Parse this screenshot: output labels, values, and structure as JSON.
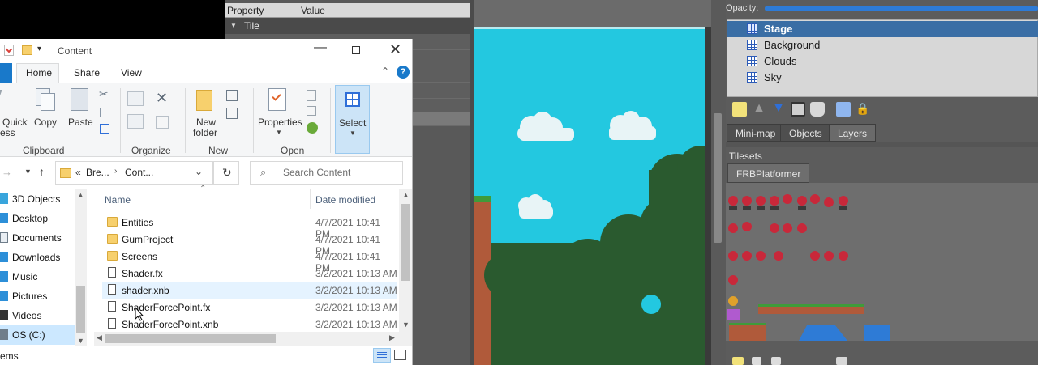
{
  "tiled": {
    "properties": {
      "col_property": "Property",
      "col_value": "Value",
      "group": "Tile"
    },
    "opacity_label": "Opacity:",
    "layers": [
      {
        "name": "Stage",
        "selected": true
      },
      {
        "name": "Background",
        "selected": false
      },
      {
        "name": "Clouds",
        "selected": false
      },
      {
        "name": "Sky",
        "selected": false
      }
    ],
    "panel_tabs": [
      "Mini-map",
      "Objects",
      "Layers"
    ],
    "active_panel_tab": "Layers",
    "tilesets_label": "Tilesets",
    "tileset_tab": "FRBPlatformer",
    "colors": {
      "sky": "#23c8e0",
      "foliage": "#2a5a2f",
      "layer_selected": "#3a6ea5",
      "enemy": "#c8283a"
    }
  },
  "explorer": {
    "window_title": "Content",
    "ribbon_tabs": [
      "Home",
      "Share",
      "View"
    ],
    "active_tab": "Home",
    "groups": {
      "clipboard": {
        "label": "Clipboard",
        "quick_access_1": "Quick",
        "quick_access_2": "ess",
        "copy": "Copy",
        "paste": "Paste"
      },
      "organize": {
        "label": "Organize"
      },
      "new": {
        "label": "New",
        "new_folder_1": "New",
        "new_folder_2": "folder"
      },
      "open": {
        "label": "Open",
        "properties": "Properties"
      },
      "select": {
        "label": "Select"
      }
    },
    "address": {
      "seg1": "Bre...",
      "seg2": "Cont...",
      "prefix": "«"
    },
    "search_placeholder": "Search Content",
    "nav_items": [
      {
        "label": "3D Objects",
        "icon": "3d-objects-icon"
      },
      {
        "label": "Desktop",
        "icon": "desktop-icon"
      },
      {
        "label": "Documents",
        "icon": "documents-icon"
      },
      {
        "label": "Downloads",
        "icon": "downloads-icon"
      },
      {
        "label": "Music",
        "icon": "music-icon"
      },
      {
        "label": "Pictures",
        "icon": "pictures-icon"
      },
      {
        "label": "Videos",
        "icon": "videos-icon"
      },
      {
        "label": "OS (C:)",
        "icon": "drive-icon"
      }
    ],
    "columns": {
      "name": "Name",
      "date": "Date modified"
    },
    "files": [
      {
        "name": "Entities",
        "date": "4/7/2021 10:41 PM",
        "type": "folder"
      },
      {
        "name": "GumProject",
        "date": "4/7/2021 10:41 PM",
        "type": "folder"
      },
      {
        "name": "Screens",
        "date": "4/7/2021 10:41 PM",
        "type": "folder"
      },
      {
        "name": "Shader.fx",
        "date": "3/2/2021 10:13 AM",
        "type": "file"
      },
      {
        "name": "shader.xnb",
        "date": "3/2/2021 10:13 AM",
        "type": "file",
        "hover": true
      },
      {
        "name": "ShaderForcePoint.fx",
        "date": "3/2/2021 10:13 AM",
        "type": "file"
      },
      {
        "name": "ShaderForcePoint.xnb",
        "date": "3/2/2021 10:13 AM",
        "type": "file"
      }
    ],
    "status_text": "ems",
    "colors": {
      "accent": "#1979ca",
      "folder": "#f7d06d"
    }
  }
}
